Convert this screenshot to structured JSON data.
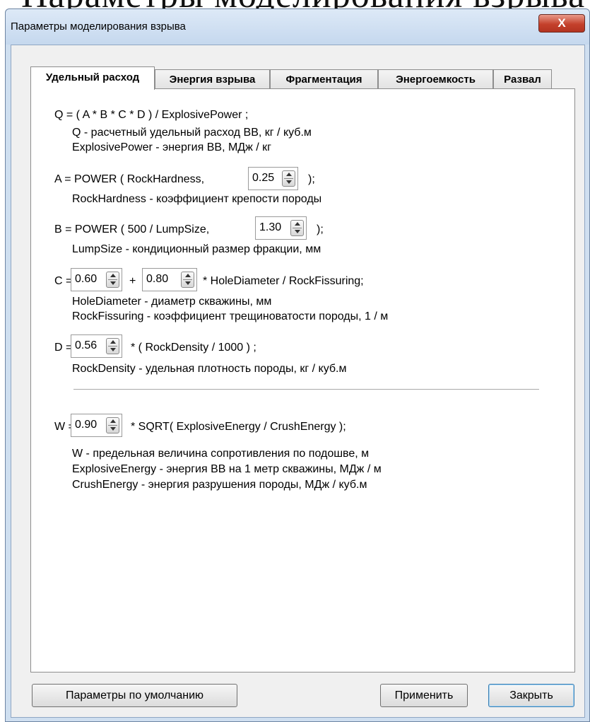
{
  "background_text": "Параметры моделирования взрыва",
  "window": {
    "title": "Параметры моделирования взрыва",
    "close_label": "X"
  },
  "tabs": [
    {
      "label": "Удельный расход",
      "active": true
    },
    {
      "label": "Энергия взрыва",
      "active": false
    },
    {
      "label": "Фрагментация",
      "active": false
    },
    {
      "label": "Энергоемкость",
      "active": false
    },
    {
      "label": "Развал",
      "active": false
    }
  ],
  "formulas": {
    "q_formula": "Q = ( A * B * C * D ) / ExplosivePower ;",
    "q_desc1": "Q - расчетный удельный расход ВВ, кг / куб.м",
    "q_desc2": "ExplosivePower - энергия ВВ, МДж / кг",
    "a_prefix": "A = POWER ( RockHardness,",
    "a_value": "0.25",
    "a_suffix": ");",
    "a_desc": "RockHardness - коэффициент  крепости породы",
    "b_prefix": "B = POWER ( 500 / LumpSize,",
    "b_value": "1.30",
    "b_suffix": ");",
    "b_desc": "LumpSize - кондиционный размер фракции, мм",
    "c_prefix": "C =",
    "c_value1": "0.60",
    "c_plus": "+",
    "c_value2": "0.80",
    "c_suffix": "* HoleDiameter / RockFissuring;",
    "c_desc1": "HoleDiameter - диаметр скважины, мм",
    "c_desc2": "RockFissuring - коэффициент трещиноватости породы, 1 / м",
    "d_prefix": "D =",
    "d_value": "0.56",
    "d_suffix": "* ( RockDensity / 1000 ) ;",
    "d_desc": "RockDensity - удельная плотность породы, кг / куб.м",
    "w_prefix": "W =",
    "w_value": "0.90",
    "w_suffix": "* SQRT( ExplosiveEnergy / CrushEnergy );",
    "w_desc1": "W - предельная величина сопротивления по подошве, м",
    "w_desc2": "ExplosiveEnergy - энергия ВВ на 1 метр скважины, МДж / м",
    "w_desc3": "CrushEnergy - энергия разрушения породы, МДж / куб.м"
  },
  "buttons": {
    "defaults": "Параметры по умолчанию",
    "apply": "Применить",
    "close": "Закрыть"
  }
}
